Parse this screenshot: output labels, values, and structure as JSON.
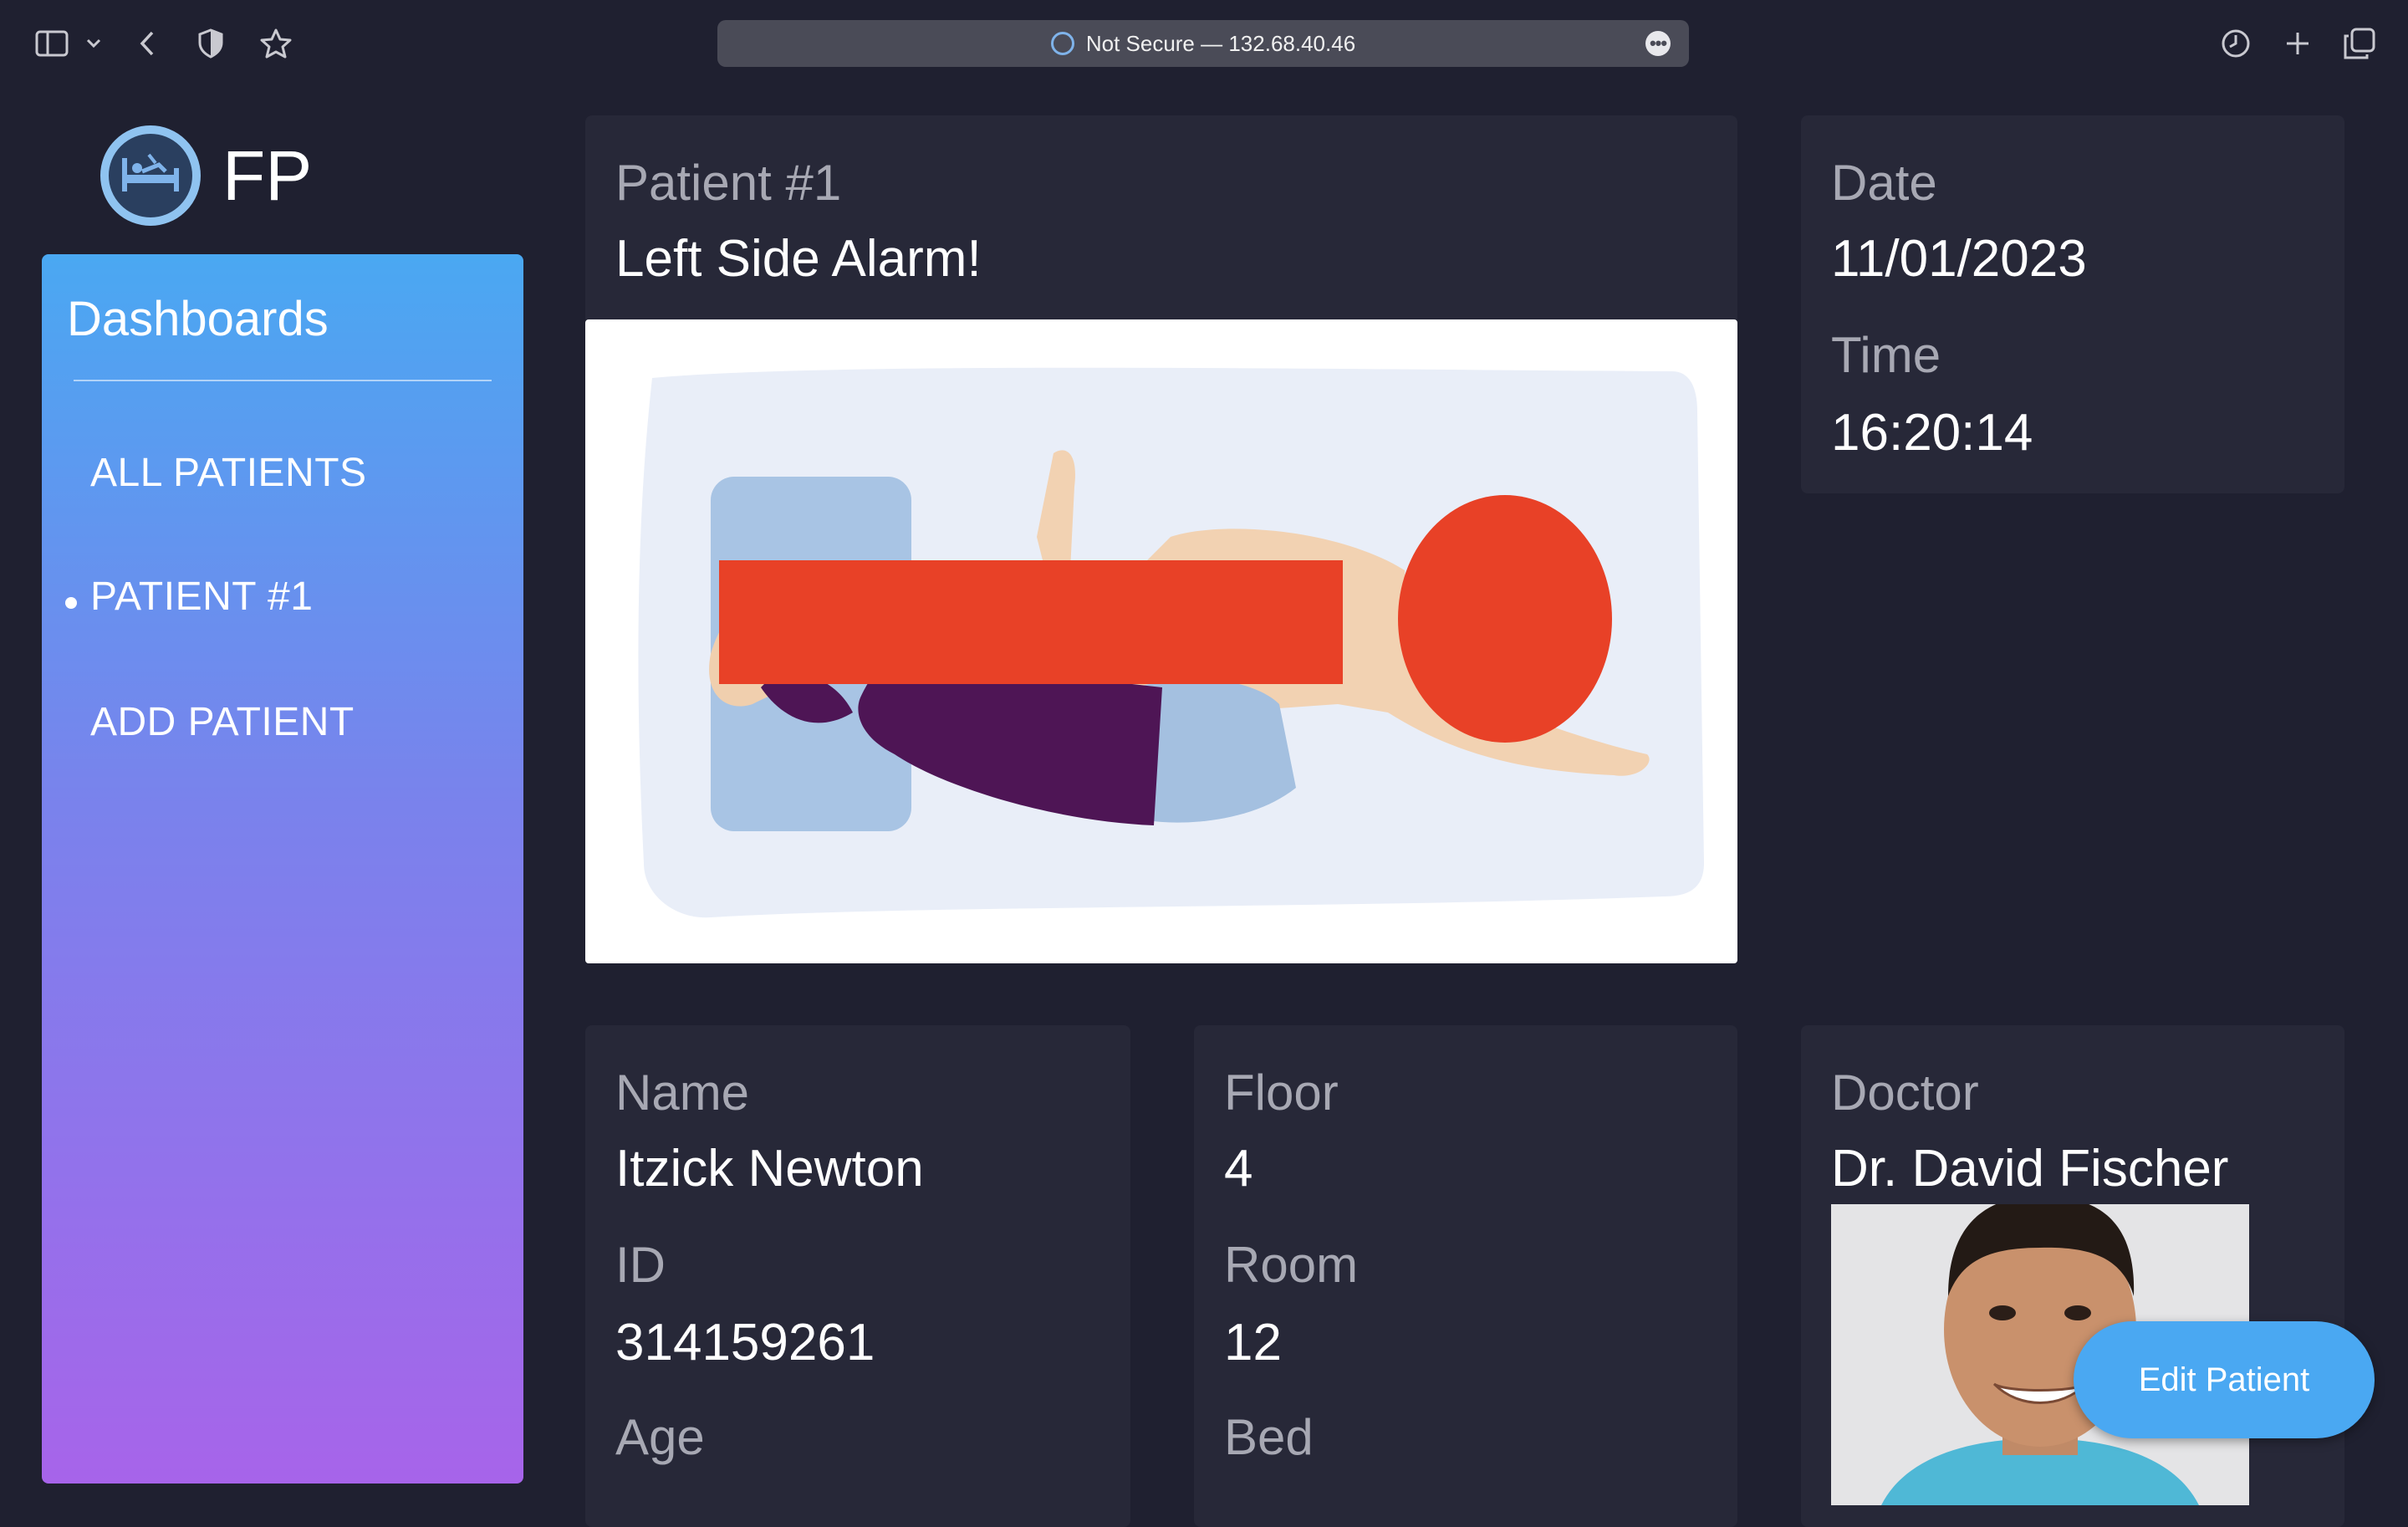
{
  "browser": {
    "url_text": "Not Secure — 132.68.40.46",
    "icons": [
      "sidebar-toggle-icon",
      "chevron-down-icon",
      "back-arrow-icon",
      "shield-icon",
      "star-icon",
      "ellipsis-icon",
      "history-clock-icon",
      "plus-icon",
      "tabs-overview-icon"
    ]
  },
  "app": {
    "logo_text": "FP"
  },
  "sidebar": {
    "title": "Dashboards",
    "items": [
      {
        "label": "ALL PATIENTS",
        "active": false
      },
      {
        "label": "PATIENT #1",
        "active": true
      },
      {
        "label": "ADD PATIENT",
        "active": false
      }
    ]
  },
  "alert": {
    "patient_label": "Patient #1",
    "message": "Left Side Alarm!"
  },
  "datetime": {
    "date_label": "Date",
    "date_value": "11/01/2023",
    "time_label": "Time",
    "time_value": "16:20:14"
  },
  "patient": {
    "name_label": "Name",
    "name_value": "Itzick Newton",
    "id_label": "ID",
    "id_value": "314159261",
    "age_label": "Age"
  },
  "location": {
    "floor_label": "Floor",
    "floor_value": "4",
    "room_label": "Room",
    "room_value": "12",
    "bed_label": "Bed"
  },
  "doctor": {
    "label": "Doctor",
    "name": "Dr. David Fischer"
  },
  "actions": {
    "edit_label": "Edit Patient"
  },
  "colors": {
    "background": "#1f2030",
    "card": "#272838",
    "accent": "#4aa8f2",
    "sidebar_gradient_top": "#4aa8f2",
    "sidebar_gradient_bottom": "#a764ea",
    "alarm_marker": "#e84127"
  }
}
